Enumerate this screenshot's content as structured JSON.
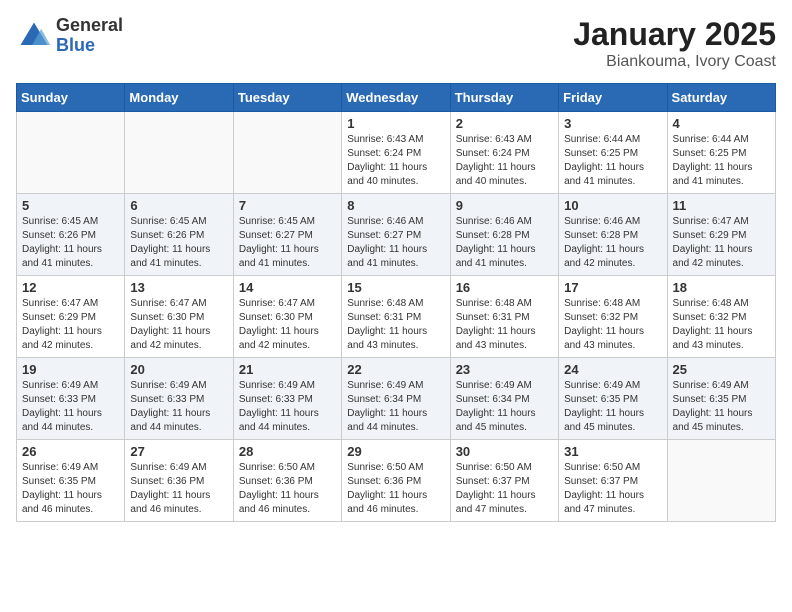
{
  "logo": {
    "general": "General",
    "blue": "Blue"
  },
  "title": "January 2025",
  "subtitle": "Biankouma, Ivory Coast",
  "days_of_week": [
    "Sunday",
    "Monday",
    "Tuesday",
    "Wednesday",
    "Thursday",
    "Friday",
    "Saturday"
  ],
  "weeks": [
    [
      {
        "day": "",
        "sunrise": "",
        "sunset": "",
        "daylight": ""
      },
      {
        "day": "",
        "sunrise": "",
        "sunset": "",
        "daylight": ""
      },
      {
        "day": "",
        "sunrise": "",
        "sunset": "",
        "daylight": ""
      },
      {
        "day": "1",
        "sunrise": "Sunrise: 6:43 AM",
        "sunset": "Sunset: 6:24 PM",
        "daylight": "Daylight: 11 hours and 40 minutes."
      },
      {
        "day": "2",
        "sunrise": "Sunrise: 6:43 AM",
        "sunset": "Sunset: 6:24 PM",
        "daylight": "Daylight: 11 hours and 40 minutes."
      },
      {
        "day": "3",
        "sunrise": "Sunrise: 6:44 AM",
        "sunset": "Sunset: 6:25 PM",
        "daylight": "Daylight: 11 hours and 41 minutes."
      },
      {
        "day": "4",
        "sunrise": "Sunrise: 6:44 AM",
        "sunset": "Sunset: 6:25 PM",
        "daylight": "Daylight: 11 hours and 41 minutes."
      }
    ],
    [
      {
        "day": "5",
        "sunrise": "Sunrise: 6:45 AM",
        "sunset": "Sunset: 6:26 PM",
        "daylight": "Daylight: 11 hours and 41 minutes."
      },
      {
        "day": "6",
        "sunrise": "Sunrise: 6:45 AM",
        "sunset": "Sunset: 6:26 PM",
        "daylight": "Daylight: 11 hours and 41 minutes."
      },
      {
        "day": "7",
        "sunrise": "Sunrise: 6:45 AM",
        "sunset": "Sunset: 6:27 PM",
        "daylight": "Daylight: 11 hours and 41 minutes."
      },
      {
        "day": "8",
        "sunrise": "Sunrise: 6:46 AM",
        "sunset": "Sunset: 6:27 PM",
        "daylight": "Daylight: 11 hours and 41 minutes."
      },
      {
        "day": "9",
        "sunrise": "Sunrise: 6:46 AM",
        "sunset": "Sunset: 6:28 PM",
        "daylight": "Daylight: 11 hours and 41 minutes."
      },
      {
        "day": "10",
        "sunrise": "Sunrise: 6:46 AM",
        "sunset": "Sunset: 6:28 PM",
        "daylight": "Daylight: 11 hours and 42 minutes."
      },
      {
        "day": "11",
        "sunrise": "Sunrise: 6:47 AM",
        "sunset": "Sunset: 6:29 PM",
        "daylight": "Daylight: 11 hours and 42 minutes."
      }
    ],
    [
      {
        "day": "12",
        "sunrise": "Sunrise: 6:47 AM",
        "sunset": "Sunset: 6:29 PM",
        "daylight": "Daylight: 11 hours and 42 minutes."
      },
      {
        "day": "13",
        "sunrise": "Sunrise: 6:47 AM",
        "sunset": "Sunset: 6:30 PM",
        "daylight": "Daylight: 11 hours and 42 minutes."
      },
      {
        "day": "14",
        "sunrise": "Sunrise: 6:47 AM",
        "sunset": "Sunset: 6:30 PM",
        "daylight": "Daylight: 11 hours and 42 minutes."
      },
      {
        "day": "15",
        "sunrise": "Sunrise: 6:48 AM",
        "sunset": "Sunset: 6:31 PM",
        "daylight": "Daylight: 11 hours and 43 minutes."
      },
      {
        "day": "16",
        "sunrise": "Sunrise: 6:48 AM",
        "sunset": "Sunset: 6:31 PM",
        "daylight": "Daylight: 11 hours and 43 minutes."
      },
      {
        "day": "17",
        "sunrise": "Sunrise: 6:48 AM",
        "sunset": "Sunset: 6:32 PM",
        "daylight": "Daylight: 11 hours and 43 minutes."
      },
      {
        "day": "18",
        "sunrise": "Sunrise: 6:48 AM",
        "sunset": "Sunset: 6:32 PM",
        "daylight": "Daylight: 11 hours and 43 minutes."
      }
    ],
    [
      {
        "day": "19",
        "sunrise": "Sunrise: 6:49 AM",
        "sunset": "Sunset: 6:33 PM",
        "daylight": "Daylight: 11 hours and 44 minutes."
      },
      {
        "day": "20",
        "sunrise": "Sunrise: 6:49 AM",
        "sunset": "Sunset: 6:33 PM",
        "daylight": "Daylight: 11 hours and 44 minutes."
      },
      {
        "day": "21",
        "sunrise": "Sunrise: 6:49 AM",
        "sunset": "Sunset: 6:33 PM",
        "daylight": "Daylight: 11 hours and 44 minutes."
      },
      {
        "day": "22",
        "sunrise": "Sunrise: 6:49 AM",
        "sunset": "Sunset: 6:34 PM",
        "daylight": "Daylight: 11 hours and 44 minutes."
      },
      {
        "day": "23",
        "sunrise": "Sunrise: 6:49 AM",
        "sunset": "Sunset: 6:34 PM",
        "daylight": "Daylight: 11 hours and 45 minutes."
      },
      {
        "day": "24",
        "sunrise": "Sunrise: 6:49 AM",
        "sunset": "Sunset: 6:35 PM",
        "daylight": "Daylight: 11 hours and 45 minutes."
      },
      {
        "day": "25",
        "sunrise": "Sunrise: 6:49 AM",
        "sunset": "Sunset: 6:35 PM",
        "daylight": "Daylight: 11 hours and 45 minutes."
      }
    ],
    [
      {
        "day": "26",
        "sunrise": "Sunrise: 6:49 AM",
        "sunset": "Sunset: 6:35 PM",
        "daylight": "Daylight: 11 hours and 46 minutes."
      },
      {
        "day": "27",
        "sunrise": "Sunrise: 6:49 AM",
        "sunset": "Sunset: 6:36 PM",
        "daylight": "Daylight: 11 hours and 46 minutes."
      },
      {
        "day": "28",
        "sunrise": "Sunrise: 6:50 AM",
        "sunset": "Sunset: 6:36 PM",
        "daylight": "Daylight: 11 hours and 46 minutes."
      },
      {
        "day": "29",
        "sunrise": "Sunrise: 6:50 AM",
        "sunset": "Sunset: 6:36 PM",
        "daylight": "Daylight: 11 hours and 46 minutes."
      },
      {
        "day": "30",
        "sunrise": "Sunrise: 6:50 AM",
        "sunset": "Sunset: 6:37 PM",
        "daylight": "Daylight: 11 hours and 47 minutes."
      },
      {
        "day": "31",
        "sunrise": "Sunrise: 6:50 AM",
        "sunset": "Sunset: 6:37 PM",
        "daylight": "Daylight: 11 hours and 47 minutes."
      },
      {
        "day": "",
        "sunrise": "",
        "sunset": "",
        "daylight": ""
      }
    ]
  ]
}
